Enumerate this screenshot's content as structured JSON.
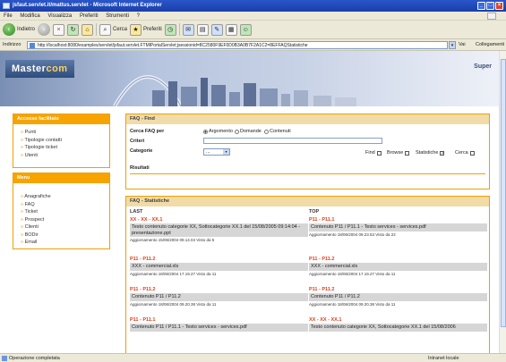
{
  "window": {
    "title": "jsfaut.servlet.it/mattus.servlet - Microsoft Internet Explorer"
  },
  "menubar": {
    "items": [
      "File",
      "Modifica",
      "Visualizza",
      "Preferiti",
      "Strumenti",
      "?"
    ]
  },
  "toolbar": {
    "back": "Indietro",
    "search": "Cerca",
    "favorites": "Preferiti"
  },
  "addressbar": {
    "label": "Indirizzo",
    "url": "http://localhost:8080/examples/servlet/jsfaut.servlet.FTMlPortalServlet;jsessionid=8C2580F9EF0D0B3A0B7F2A1C2=8EFFAQStatistiche",
    "go": "Vai",
    "links": "Collegamenti"
  },
  "status": {
    "text": "Operazione completata",
    "zone": "Intranet locale"
  },
  "header": {
    "logo_part1": "Master",
    "logo_part2": "com",
    "user": "Super"
  },
  "accesso": {
    "title": "Accesso facilitato",
    "items": [
      "Punti",
      "Tipologie contatti",
      "Tipologie ticket",
      "Utenti"
    ]
  },
  "menu": {
    "title": "Menu",
    "items": [
      "Anagrafiche",
      "FAQ",
      "Ticket",
      "Prospect",
      "Clienti",
      "BODir",
      "Email"
    ]
  },
  "faqfind": {
    "title": "FAQ - Find",
    "cerca_label": "Cerca FAQ per",
    "radios": [
      "Argomento",
      "Domande",
      "Contenuti"
    ],
    "criteri_label": "Criteri",
    "categorie_label": "Categorie",
    "select_value": "...",
    "checks": [
      {
        "label": "Find",
        "checked": false
      },
      {
        "label": "Browse",
        "checked": false
      },
      {
        "label": "Statistiche",
        "checked": true
      },
      {
        "label": "Cerca",
        "checked": false
      }
    ],
    "risultati_label": "Risultati"
  },
  "stats": {
    "title": "FAQ - Statistiche",
    "last_label": "LAST",
    "top_label": "TOP",
    "last": [
      {
        "title": "XX - XX - XX.1",
        "content": "Testo contenuto categorie XX, Sottocategorie XX.1 del 15/08/2005 09:14:04 - presentazione.ppt",
        "meta": "Aggiornamento 15/06/2004 09.14.04 Visto da 5"
      },
      {
        "title": "P11 - P11.2",
        "content": "XXX - commercial.xls",
        "meta": "Aggiornamento 18/06/2004 17.19.27 Visto da 11"
      },
      {
        "title": "P11 - P11.2",
        "content": "Contenuto P11 / P11.2",
        "meta": "Aggiornamento 18/06/2004 09.20.38 Visto da 11"
      },
      {
        "title": "P11 - P11.1",
        "content": "Contenuto P11 / P11.1 - Testo services - services.pdf",
        "meta": ""
      }
    ],
    "top": [
      {
        "title": "P11 - P11.1",
        "content": "Contenuto P11 / P11.1 - Testo services - services.pdf",
        "meta": "Aggiornamento 18/06/2004 09.23.53 Visto da 22"
      },
      {
        "title": "P11 - P11.2",
        "content": "XXX - commercial.xls",
        "meta": "Aggiornamento 18/06/2004 17.19.27 Visto da 11"
      },
      {
        "title": "P11 - P11.2",
        "content": "Contenuto P11 / P11.2",
        "meta": "Aggiornamento 18/06/2004 09.20.38 Visto da 11"
      },
      {
        "title": "XX - XX - XX.1",
        "content": "Testo contenuto categorie XX, Sottocategorie XX.1 del 15/08/2006",
        "meta": ""
      }
    ]
  },
  "colors": {
    "orange": "#f7a400",
    "title_red": "#e23c16",
    "xp_blue": "#2a56c9"
  }
}
